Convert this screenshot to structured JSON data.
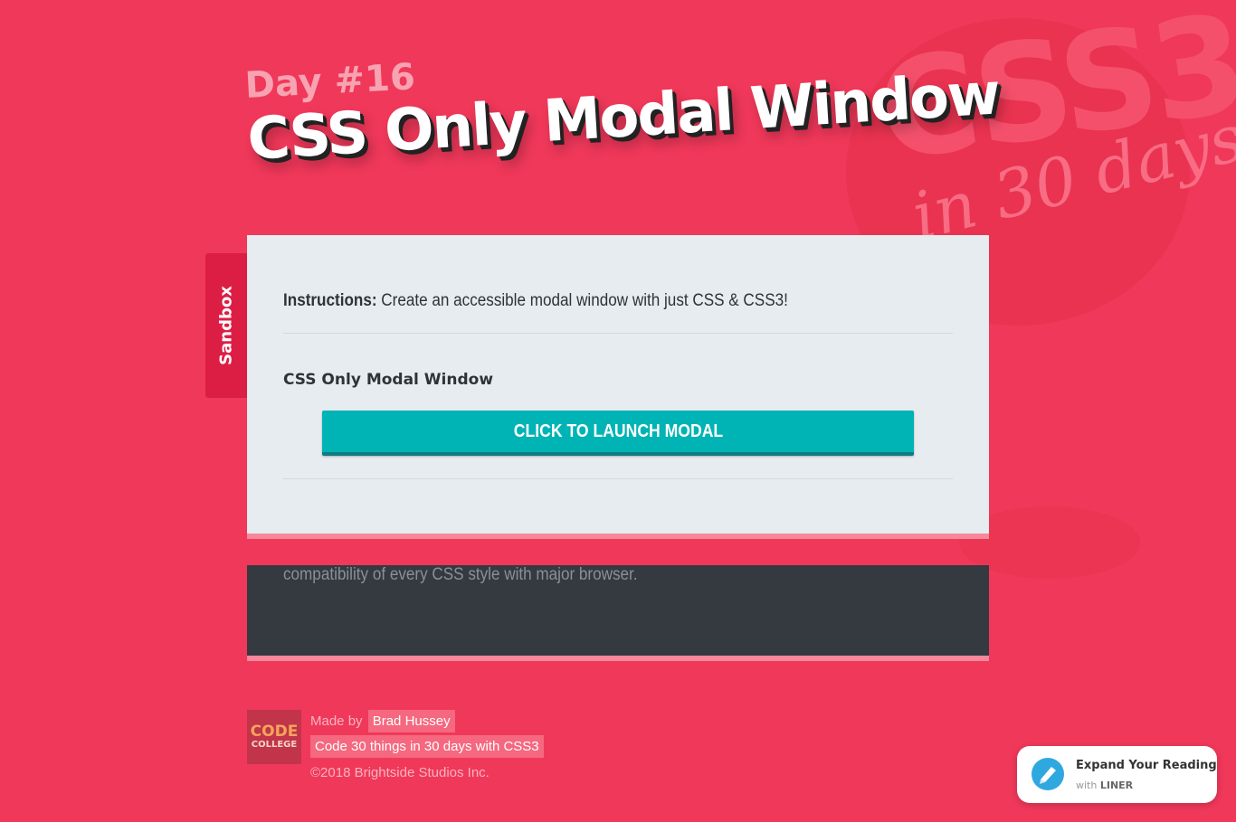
{
  "background": {
    "watermark_main": "CSS3",
    "watermark_sub": "in 30 days"
  },
  "header": {
    "day_label": "Day #16",
    "title": "CSS Only Modal Window"
  },
  "sandbox_tab": {
    "label": "Sandbox"
  },
  "card": {
    "instructions_label": "Instructions:",
    "instructions_text": " Create an accessible modal window with just CSS & CSS3!",
    "section_heading": "CSS Only Modal Window",
    "launch_button_label": "CLICK TO LAUNCH MODAL"
  },
  "dark_card": {
    "text": "compatibility of every CSS style with major browser."
  },
  "footer": {
    "logo_line1": "CODE",
    "logo_line2": "COLLEGE",
    "made_by_prefix": "Made by",
    "author_link": "Brad Hussey",
    "course_link": "Code 30 things in 30 days with CSS3",
    "copyright": "©2018 Brightside Studios Inc."
  },
  "liner_widget": {
    "title": "Expand Your Reading",
    "sub_prefix": "with",
    "brand": "LINER",
    "icon": "liner-icon"
  },
  "colors": {
    "page_background": "#f0385a",
    "accent_teal": "#00b3b5",
    "card_background": "#e6ecf0",
    "dark_card_background": "#343a40",
    "sandbox_tab": "#dd1e44"
  }
}
